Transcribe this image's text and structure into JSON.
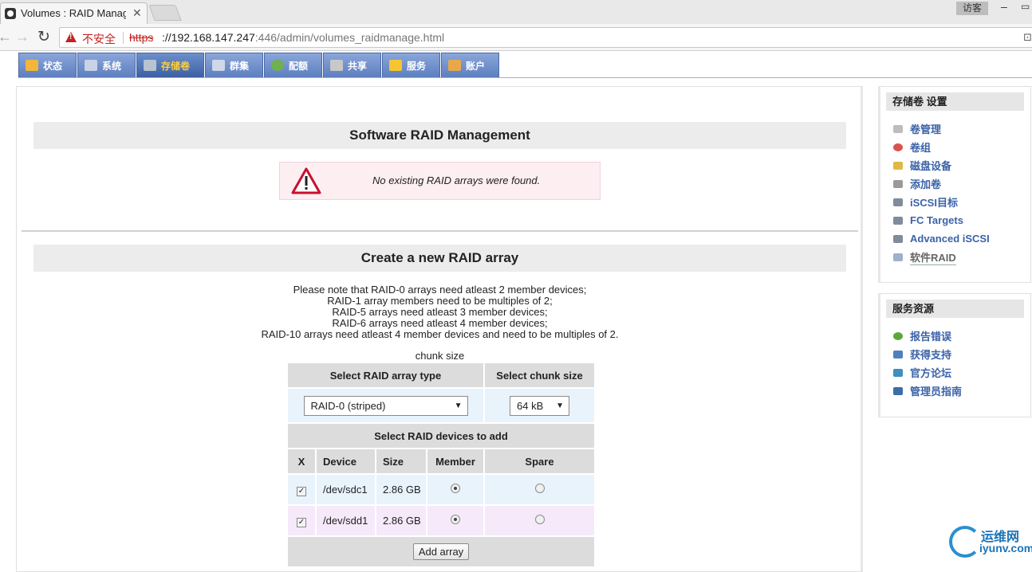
{
  "browser": {
    "tab_title": "Volumes : RAID Manag",
    "tab_close": "✕",
    "guest_label": "访客",
    "insecure_label": "不安全",
    "url_scheme": "https",
    "url_host": "://192.168.147.247",
    "url_rest": ":446/admin/volumes_raidmanage.html"
  },
  "topnav": {
    "tabs": [
      {
        "label": "状态",
        "color": "#f2b63c"
      },
      {
        "label": "系统",
        "color": "#c9d3e6"
      },
      {
        "label": "存储卷",
        "color": "#b8c3d0",
        "active": true
      },
      {
        "label": "群集",
        "color": "#d0d7e6"
      },
      {
        "label": "配额",
        "color": "#6fb04f"
      },
      {
        "label": "共享",
        "color": "#c8c8c8"
      },
      {
        "label": "服务",
        "color": "#f7c531"
      },
      {
        "label": "账户",
        "color": "#e8a84a"
      }
    ]
  },
  "raid_management": {
    "title": "Software RAID Management",
    "alert_text": "No existing RAID arrays were found."
  },
  "create_array": {
    "title": "Create a new RAID array",
    "note_lines": [
      "Please note that RAID-0 arrays need atleast 2 member devices;",
      "RAID-1 array members need to be multiples of 2;",
      "RAID-5 arrays need atleast 3 member devices;",
      "RAID-6 arrays need atleast 4 member devices;",
      "RAID-10 arrays need atleast 4 member devices and need to be multiples of 2."
    ],
    "chunk_caption": "chunk size",
    "type_header": "Select RAID array type",
    "chunk_header": "Select chunk size",
    "type_value": "RAID-0 (striped)",
    "chunk_value": "64 kB",
    "devices_header": "Select RAID devices to add",
    "columns": [
      "X",
      "Device",
      "Size",
      "Member",
      "Spare"
    ],
    "devices": [
      {
        "checked": true,
        "device": "/dev/sdc1",
        "size": "2.86 GB",
        "member": true,
        "spare": false
      },
      {
        "checked": true,
        "device": "/dev/sdd1",
        "size": "2.86 GB",
        "member": true,
        "spare": false
      }
    ],
    "add_button": "Add array"
  },
  "sidebar": {
    "settings_title": "存储卷 设置",
    "settings_items": [
      {
        "label": "卷管理",
        "color": "#bdbdbd"
      },
      {
        "label": "卷组",
        "color": "#d9534f"
      },
      {
        "label": "磁盘设备",
        "color": "#e0b84a"
      },
      {
        "label": "添加卷",
        "color": "#9a9a9a"
      },
      {
        "label": "iSCSI目标",
        "color": "#7f8c9a"
      },
      {
        "label": "FC Targets",
        "color": "#7f8c9a"
      },
      {
        "label": "Advanced iSCSI",
        "color": "#7f8c9a"
      },
      {
        "label": "软件RAID",
        "color": "#9fb0cc",
        "current": true
      }
    ],
    "resources_title": "服务资源",
    "resources_items": [
      {
        "label": "报告错误",
        "color": "#5aa83a"
      },
      {
        "label": "获得支持",
        "color": "#4f7fbf"
      },
      {
        "label": "官方论坛",
        "color": "#3f8fbf"
      },
      {
        "label": "管理员指南",
        "color": "#3c6da8"
      }
    ]
  },
  "watermark": {
    "cn": "运维网",
    "en": "iyunv.com"
  }
}
